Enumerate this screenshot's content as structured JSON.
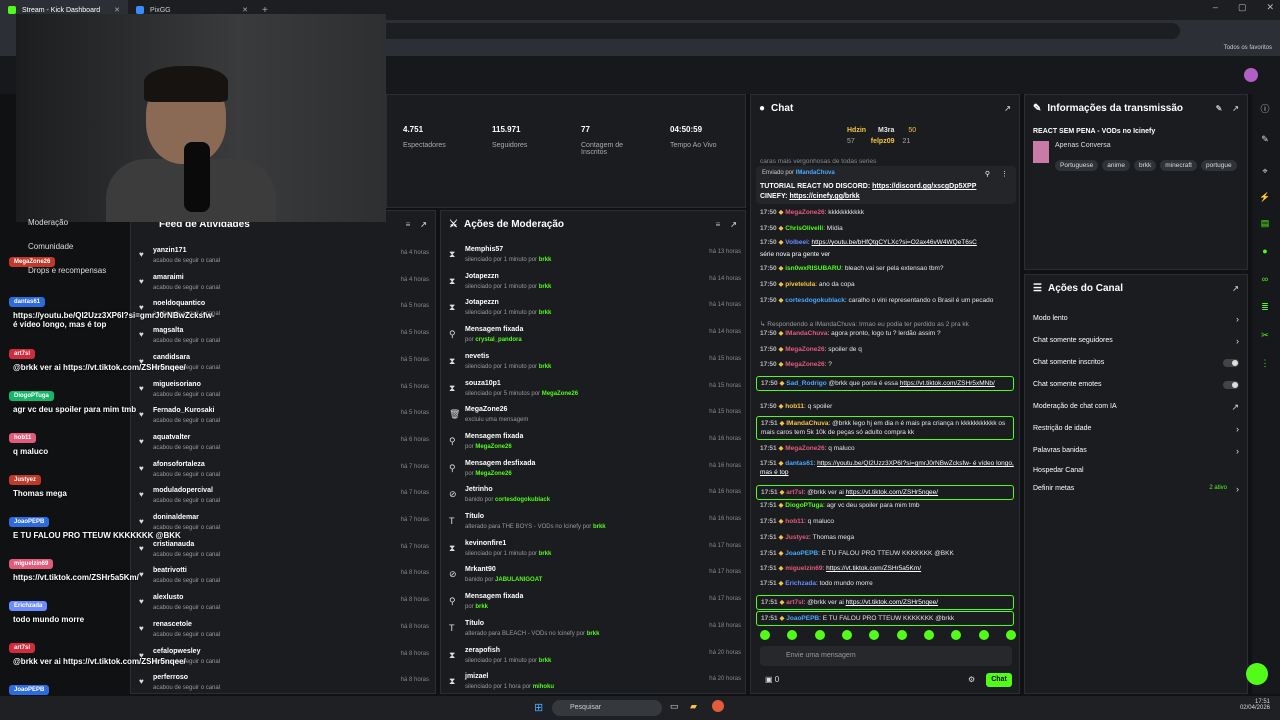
{
  "browser": {
    "tabs": [
      {
        "label": "Stream - Kick Dashboard"
      },
      {
        "label": "PixGG"
      }
    ],
    "bookmarks_label": "Todos os favoritos"
  },
  "stats": [
    {
      "value": "4.751",
      "label": "Espectadores"
    },
    {
      "value": "115.971",
      "label": "Seguidores"
    },
    {
      "value": "77",
      "label": "Contagem de Inscritos"
    },
    {
      "value": "04:50:59",
      "label": "Tempo Ao Vivo"
    }
  ],
  "leftnav": {
    "moderation": "Moderação",
    "community": "Comunidade",
    "drops": "Drops e recompensas"
  },
  "overlay_chat": [
    {
      "name": "MegaZone26",
      "msg": "",
      "color": "#c0392b"
    },
    {
      "name": "dantas61",
      "msg": "https://youtu.be/QI2Uzz3XP6I?si=gmrJ0rNBwZcksfw- é vídeo longo, mas é top",
      "color": "#2d6cdf"
    },
    {
      "name": "art7sl",
      "msg": "@brkk ver ai https://vt.tiktok.com/ZSHr5nqee/",
      "color": "#d12b3e"
    },
    {
      "name": "DiogoPTuga",
      "msg": "agr vc deu spoiler para mim tmb",
      "color": "#16b66b"
    },
    {
      "name": "hob11",
      "msg": "q maluco",
      "color": "#e25b7b"
    },
    {
      "name": "Justyez",
      "msg": "Thomas mega",
      "color": "#c0392b"
    },
    {
      "name": "JoaoPEPB",
      "msg": "E TU FALOU PRO TTEUW KKKKKKK @BKK",
      "color": "#2d6cdf"
    },
    {
      "name": "miguelzin69",
      "msg": "https://vt.tiktok.com/ZSHr5a5Km/",
      "color": "#e25b7b"
    },
    {
      "name": "Erichzada",
      "msg": "todo mundo morre",
      "color": "#6c8cff"
    },
    {
      "name": "art7sl",
      "msg": "@brkk ver ai https://vt.tiktok.com/ZSHr5nqee/",
      "color": "#d12b3e"
    },
    {
      "name": "JoaoPEPB",
      "msg": "E TU FALOU PRO TTEUW KKKKKKK @BRKK",
      "color": "#2d6cdf"
    }
  ],
  "feed": {
    "title": "Feed de Atividades",
    "rows": [
      {
        "name": "yanzin171",
        "sub": "acabou de seguir o canal",
        "time": "há 4 horas"
      },
      {
        "name": "amaraimi",
        "sub": "acabou de seguir o canal",
        "time": "há 4 horas"
      },
      {
        "name": "noeldoquantico",
        "sub": "acabou de seguir o canal",
        "time": "há 5 horas"
      },
      {
        "name": "magsalta",
        "sub": "acabou de seguir o canal",
        "time": "há 5 horas"
      },
      {
        "name": "candidsara",
        "sub": "acabou de seguir o canal",
        "time": "há 5 horas"
      },
      {
        "name": "migueisoriano",
        "sub": "acabou de seguir o canal",
        "time": "há 5 horas"
      },
      {
        "name": "Fernado_Kurosaki",
        "sub": "acabou de seguir o canal",
        "time": "há 5 horas"
      },
      {
        "name": "aquatvalter",
        "sub": "acabou de seguir o canal",
        "time": "há 6 horas"
      },
      {
        "name": "afonsofortaleza",
        "sub": "acabou de seguir o canal",
        "time": "há 7 horas"
      },
      {
        "name": "moduladopercival",
        "sub": "acabou de seguir o canal",
        "time": "há 7 horas"
      },
      {
        "name": "doninaldemar",
        "sub": "acabou de seguir o canal",
        "time": "há 7 horas"
      },
      {
        "name": "cristianauda",
        "sub": "acabou de seguir o canal",
        "time": "há 7 horas"
      },
      {
        "name": "beatrivotti",
        "sub": "acabou de seguir o canal",
        "time": "há 8 horas"
      },
      {
        "name": "alexlusto",
        "sub": "acabou de seguir o canal",
        "time": "há 8 horas"
      },
      {
        "name": "renascetole",
        "sub": "acabou de seguir o canal",
        "time": "há 8 horas"
      },
      {
        "name": "cefalopwesley",
        "sub": "acabou de seguir o canal",
        "time": "há 8 horas"
      },
      {
        "name": "perferroso",
        "sub": "acabou de seguir o canal",
        "time": "há 8 horas"
      }
    ]
  },
  "mod": {
    "title": "Ações de Moderação",
    "rows": [
      {
        "icon": "⧗",
        "name": "Memphis57",
        "pre": "silenciado por 1 minuto por ",
        "by": "brkk",
        "time": "há 13 horas"
      },
      {
        "icon": "⧗",
        "name": "Jotapezzn",
        "pre": "silenciado por 1 minuto por ",
        "by": "brkk",
        "time": "há 14 horas"
      },
      {
        "icon": "⧗",
        "name": "Jotapezzn",
        "pre": "silenciado por 1 minuto por ",
        "by": "brkk",
        "time": "há 14 horas"
      },
      {
        "icon": "⚲",
        "name": "Mensagem fixada",
        "pre": "por ",
        "by": "crystal_pandora",
        "time": "há 14 horas"
      },
      {
        "icon": "⧗",
        "name": "nevetis",
        "pre": "silenciado por 1 minuto por ",
        "by": "brkk",
        "time": "há 15 horas"
      },
      {
        "icon": "⧗",
        "name": "souza10p1",
        "pre": "silenciado por 5 minutos por ",
        "by": "MegaZone26",
        "time": "há 15 horas"
      },
      {
        "icon": "🗑",
        "name": "MegaZone26",
        "pre": "excluiu uma mensagem",
        "by": "",
        "time": "há 15 horas"
      },
      {
        "icon": "⚲",
        "name": "Mensagem fixada",
        "pre": "por ",
        "by": "MegaZone26",
        "time": "há 16 horas"
      },
      {
        "icon": "⚲",
        "name": "Mensagem desfixada",
        "pre": "por ",
        "by": "MegaZone26",
        "time": "há 16 horas"
      },
      {
        "icon": "⊘",
        "name": "Jetrinho",
        "pre": "banido por ",
        "by": "cortesdogokublack",
        "time": "há 16 horas"
      },
      {
        "icon": "T",
        "name": "Título",
        "pre": "alterado para THE BOYS - VODs no Icinefy por ",
        "by": "brkk",
        "time": "há 16 horas"
      },
      {
        "icon": "⧗",
        "name": "kevinonfire1",
        "pre": "silenciado por 1 minuto por ",
        "by": "brkk",
        "time": "há 17 horas"
      },
      {
        "icon": "⊘",
        "name": "Mrkant90",
        "pre": "banido por ",
        "by": "JABULANIGOAT",
        "time": "há 17 horas"
      },
      {
        "icon": "⚲",
        "name": "Mensagem fixada",
        "pre": "por ",
        "by": "brkk",
        "time": "há 17 horas"
      },
      {
        "icon": "T",
        "name": "Título",
        "pre": "alterado para BLEACH - VODs no Icinefy por ",
        "by": "brkk",
        "time": "há 18 horas"
      },
      {
        "icon": "⧗",
        "name": "zerapofish",
        "pre": "silenciado por 1 minuto por ",
        "by": "brkk",
        "time": "há 20 horas"
      },
      {
        "icon": "⧗",
        "name": "jmizael",
        "pre": "silenciado por 1 hora por ",
        "by": "mihoku",
        "time": "há 20 horas"
      }
    ]
  },
  "chat": {
    "title": "Chat",
    "top_gifters": [
      {
        "name": "Hdzin",
        "count": "57"
      },
      {
        "name": "M3ra",
        "count": "50"
      },
      {
        "name": "felpz09",
        "count": "21"
      }
    ],
    "partial_line": "caras mais vergonhosas de todas series",
    "pinned_by_label": "Enviado por",
    "pinned_by": "IMandaChuva",
    "pinned_text_1": "TUTORIAL REACT NO DISCORD: ",
    "pinned_link_1": "https://discord.gg/xscgDp5XPP",
    "pinned_text_2": "CINEFY: ",
    "pinned_link_2": "https://cinefy.gg/brkk",
    "messages": [
      {
        "time": "17:50",
        "user": "MegaZone26",
        "color": "#e25b7b",
        "text": ": kkkkkkkkkkk",
        "link": ""
      },
      {
        "time": "17:50",
        "user": "ChrisOlivelli",
        "color": "#53fc18",
        "text": ": Mídia",
        "link": ""
      },
      {
        "time": "17:50",
        "user": "Volbeei",
        "color": "#6c8cff",
        "text": ": ",
        "link": "https://youtu.be/bHfQtgCYLXc?si=O2ax46vW4WQeT6sC"
      },
      {
        "time": "",
        "user": "",
        "color": "#fff",
        "text": "série nova pra gente ver",
        "link": ""
      },
      {
        "time": "17:50",
        "user": "isn0wxRISUBARU",
        "color": "#53fc18",
        "text": ": bleach vai ser pela extensao tbm?",
        "link": ""
      },
      {
        "time": "17:50",
        "user": "pivetelula",
        "color": "#f4c542",
        "text": ": ano da copa",
        "link": ""
      },
      {
        "time": "17:50",
        "user": "cortesdogokublack",
        "color": "#4aa8ff",
        "text": ": caralho o vini representando o Brasil é um pecado",
        "link": ""
      },
      {
        "time": "",
        "user": "",
        "color": "#999",
        "text": "↳ Respondendo a IMandaChuva: Irmao eu podia ter perdido as 2 pra kk",
        "link": ""
      },
      {
        "time": "17:50",
        "user": "IMandaChuva",
        "color": "#e25b7b",
        "text": ": agora pronto, logo tu ? lerdão assim ?",
        "link": ""
      },
      {
        "time": "17:50",
        "user": "MegaZone26",
        "color": "#e25b7b",
        "text": ": spoiler de q",
        "link": ""
      },
      {
        "time": "17:50",
        "user": "MegaZone26",
        "color": "#e25b7b",
        "text": ": ?",
        "link": ""
      },
      {
        "time": "17:50",
        "user": "Sad_Rodrigo",
        "color": "#4aa8ff",
        "text": " @brkk que porra é essa ",
        "link": "https://vt.tiktok.com/ZSHr5xMNb/"
      },
      {
        "time": "17:50",
        "user": "hob11",
        "color": "#f4c542",
        "text": ": q spoiler",
        "link": ""
      },
      {
        "time": "17:51",
        "user": "IMandaChuva",
        "color": "#f4c542",
        "text": ": @brkk lego hj em dia n é mais pra criança n kkkkkkkkkkk os mais caros tem 5k 10k de peças só adulto compra kk",
        "link": ""
      },
      {
        "time": "17:51",
        "user": "MegaZone26",
        "color": "#e25b7b",
        "text": ": q maluco",
        "link": ""
      },
      {
        "time": "17:51",
        "user": "dantas61",
        "color": "#4aa8ff",
        "text": ": ",
        "link": "https://youtu.be/QI2Uzz3XP6I?si=gmrJ0rNBwZcksfw- é vídeo longo, mas é top"
      },
      {
        "time": "17:51",
        "user": "art7sl",
        "color": "#e25b7b",
        "text": ": @brkk ver ai ",
        "link": "https://vt.tiktok.com/ZSHr5nqee/"
      },
      {
        "time": "17:51",
        "user": "DiogoPTuga",
        "color": "#53fc18",
        "text": ": agr vc deu spoiler para mim tmb",
        "link": ""
      },
      {
        "time": "17:51",
        "user": "hob11",
        "color": "#e25b7b",
        "text": ": q maluco",
        "link": ""
      },
      {
        "time": "17:51",
        "user": "Justyez",
        "color": "#e25b7b",
        "text": ": Thomas mega",
        "link": ""
      },
      {
        "time": "17:51",
        "user": "JoaoPEPB",
        "color": "#4aa8ff",
        "text": ": E TU FALOU PRO TTEUW KKKKKKK @BKK",
        "link": ""
      },
      {
        "time": "17:51",
        "user": "miguelzin69",
        "color": "#e25b7b",
        "text": ": ",
        "link": "https://vt.tiktok.com/ZSHr5a5Km/"
      },
      {
        "time": "17:51",
        "user": "Erichzada",
        "color": "#6c8cff",
        "text": ": todo mundo morre",
        "link": ""
      },
      {
        "time": "17:51",
        "user": "art7sl",
        "color": "#e25b7b",
        "text": ": @brkk ver ai ",
        "link": "https://vt.tiktok.com/ZSHr5nqee/"
      },
      {
        "time": "17:51",
        "user": "JoaoPEPB",
        "color": "#4aa8ff",
        "text": ": E TU FALOU PRO TTEUW KKKKKKK @brkk",
        "link": ""
      }
    ],
    "input_placeholder": "Envie uma mensagem",
    "count": "0",
    "send_label": "Chat"
  },
  "info": {
    "title": "Informações da transmissão",
    "stream_title": "REACT SEM PENA - VODs no Icinefy",
    "category": "Apenas Conversa",
    "tags": [
      "Portuguese",
      "anime",
      "brkk",
      "minecraft",
      "portugue"
    ]
  },
  "actions": {
    "title": "Ações do Canal",
    "rows": [
      {
        "label": "Modo lento",
        "kind": "chevron"
      },
      {
        "label": "Chat somente seguidores",
        "kind": "chevron"
      },
      {
        "label": "Chat somente inscritos",
        "kind": "toggle"
      },
      {
        "label": "Chat somente emotes",
        "kind": "toggle"
      },
      {
        "label": "Moderação de chat com IA",
        "kind": "link"
      },
      {
        "label": "Restrição de idade",
        "kind": "chevron"
      },
      {
        "label": "Palavras banidas",
        "kind": "chevron"
      },
      {
        "label": "Hospedar Canal",
        "kind": "none"
      },
      {
        "label": "Definir metas",
        "kind": "chevron"
      }
    ],
    "metas_badge": "2 ativo"
  },
  "taskbar": {
    "search": "Pesquisar",
    "time": "17:51",
    "date": "02/04/2026"
  },
  "colors": {
    "accent": "#53fc18",
    "panel": "#1a1c1f",
    "bg": "#0f1113"
  }
}
